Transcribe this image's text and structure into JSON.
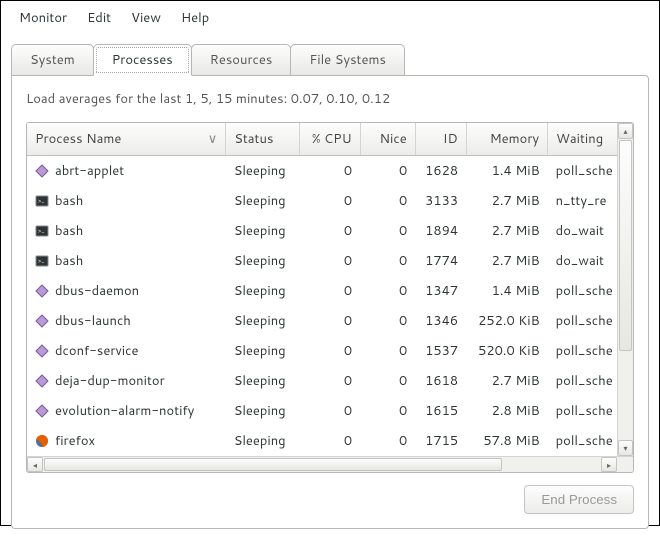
{
  "menubar": [
    "Monitor",
    "Edit",
    "View",
    "Help"
  ],
  "tabs": [
    "System",
    "Processes",
    "Resources",
    "File Systems"
  ],
  "active_tab": 1,
  "load_avg_text": "Load averages for the last 1, 5, 15 minutes: 0.07, 0.10, 0.12",
  "columns": {
    "name": "Process Name",
    "status": "Status",
    "cpu": "% CPU",
    "nice": "Nice",
    "id": "ID",
    "memory": "Memory",
    "waiting": "Waiting"
  },
  "sort_column": "name",
  "sort_indicator": "∨",
  "processes": [
    {
      "icon": "diamond",
      "name": "abrt-applet",
      "status": "Sleeping",
      "cpu": "0",
      "nice": "0",
      "id": "1628",
      "memory": "1.4 MiB",
      "waiting": "poll_sche"
    },
    {
      "icon": "terminal",
      "name": "bash",
      "status": "Sleeping",
      "cpu": "0",
      "nice": "0",
      "id": "3133",
      "memory": "2.7 MiB",
      "waiting": "n_tty_re"
    },
    {
      "icon": "terminal",
      "name": "bash",
      "status": "Sleeping",
      "cpu": "0",
      "nice": "0",
      "id": "1894",
      "memory": "2.7 MiB",
      "waiting": "do_wait"
    },
    {
      "icon": "terminal",
      "name": "bash",
      "status": "Sleeping",
      "cpu": "0",
      "nice": "0",
      "id": "1774",
      "memory": "2.7 MiB",
      "waiting": "do_wait"
    },
    {
      "icon": "diamond",
      "name": "dbus-daemon",
      "status": "Sleeping",
      "cpu": "0",
      "nice": "0",
      "id": "1347",
      "memory": "1.4 MiB",
      "waiting": "poll_sche"
    },
    {
      "icon": "diamond",
      "name": "dbus-launch",
      "status": "Sleeping",
      "cpu": "0",
      "nice": "0",
      "id": "1346",
      "memory": "252.0 KiB",
      "waiting": "poll_sche"
    },
    {
      "icon": "diamond",
      "name": "dconf-service",
      "status": "Sleeping",
      "cpu": "0",
      "nice": "0",
      "id": "1537",
      "memory": "520.0 KiB",
      "waiting": "poll_sche"
    },
    {
      "icon": "diamond",
      "name": "deja-dup-monitor",
      "status": "Sleeping",
      "cpu": "0",
      "nice": "0",
      "id": "1618",
      "memory": "2.7 MiB",
      "waiting": "poll_sche"
    },
    {
      "icon": "diamond",
      "name": "evolution-alarm-notify",
      "status": "Sleeping",
      "cpu": "0",
      "nice": "0",
      "id": "1615",
      "memory": "2.8 MiB",
      "waiting": "poll_sche"
    },
    {
      "icon": "firefox",
      "name": "firefox",
      "status": "Sleeping",
      "cpu": "0",
      "nice": "0",
      "id": "1715",
      "memory": "57.8 MiB",
      "waiting": "poll_sche"
    }
  ],
  "end_process_label": "End Process"
}
